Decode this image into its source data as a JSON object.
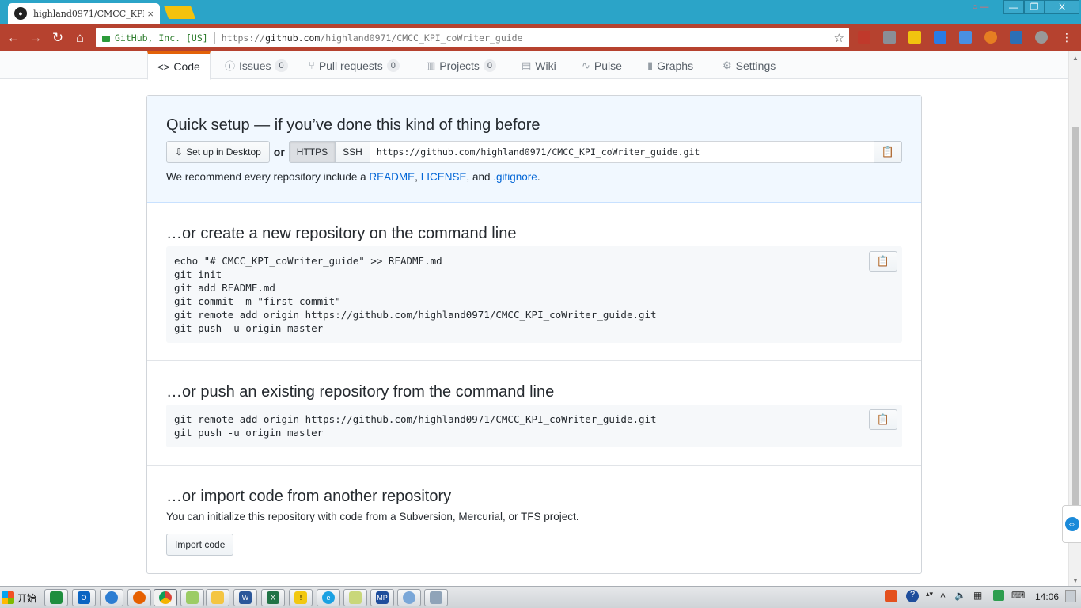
{
  "browser": {
    "tab_title": "highland0971/CMCC_KPI_",
    "tab_close": "×",
    "window_controls": {
      "profile": "○ —",
      "minimize": "—",
      "maximize": "❐",
      "close": "X"
    },
    "omnibox": {
      "origin": "GitHub, Inc. [US]",
      "scheme": "https://",
      "host": "github.com",
      "path": "/highland0971/CMCC_KPI_coWriter_guide"
    },
    "nav": {
      "back": "←",
      "forward": "→",
      "reload": "↻",
      "home": "⌂",
      "star": "☆"
    }
  },
  "repo_nav": {
    "code": "Code",
    "issues": "Issues",
    "issues_count": "0",
    "pull_requests": "Pull requests",
    "pull_requests_count": "0",
    "projects": "Projects",
    "projects_count": "0",
    "wiki": "Wiki",
    "pulse": "Pulse",
    "graphs": "Graphs",
    "settings": "Settings"
  },
  "quick_setup": {
    "title": "Quick setup — if you’ve done this kind of thing before",
    "desktop_button": "Set up in Desktop",
    "or": "or",
    "https": "HTTPS",
    "ssh": "SSH",
    "clone_url": "https://github.com/highland0971/CMCC_KPI_coWriter_guide.git",
    "recommend_prefix": "We recommend every repository include a",
    "readme": "README",
    "comma1": ",",
    "license": "LICENSE",
    "and": ", and",
    "gitignore": ".gitignore",
    "period": "."
  },
  "new_repo": {
    "title": "…or create a new repository on the command line",
    "code": "echo \"# CMCC_KPI_coWriter_guide\" >> README.md\ngit init\ngit add README.md\ngit commit -m \"first commit\"\ngit remote add origin https://github.com/highland0971/CMCC_KPI_coWriter_guide.git\ngit push -u origin master"
  },
  "push_existing": {
    "title": "…or push an existing repository from the command line",
    "code": "git remote add origin https://github.com/highland0971/CMCC_KPI_coWriter_guide.git\ngit push -u origin master"
  },
  "import": {
    "title": "…or import code from another repository",
    "text": "You can initialize this repository with code from a Subversion, Mercurial, or TFS project.",
    "button": "Import code"
  },
  "taskbar": {
    "start": "开始",
    "clock": "14:06"
  }
}
